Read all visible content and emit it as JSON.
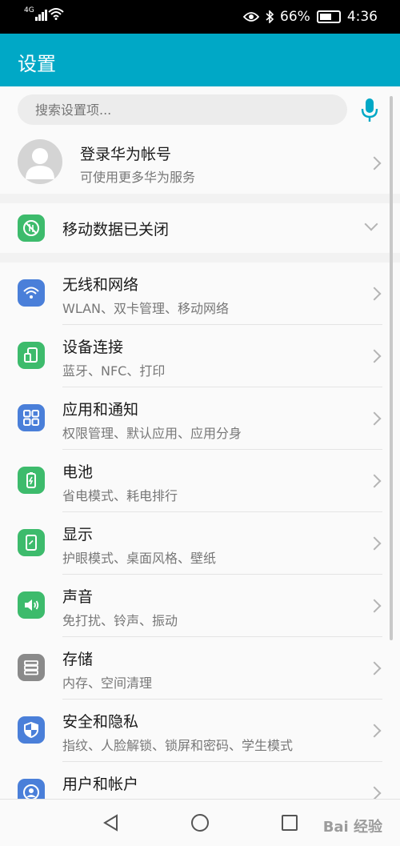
{
  "status_bar": {
    "network": "4G",
    "battery_percent": "66%",
    "time": "4:36"
  },
  "app_bar": {
    "title": "设置"
  },
  "search": {
    "placeholder": "搜索设置项..."
  },
  "account": {
    "title": "登录华为帐号",
    "subtitle": "可使用更多华为服务"
  },
  "mobile_data": {
    "label": "移动数据已关闭"
  },
  "settings": [
    {
      "title": "无线和网络",
      "subtitle": "WLAN、双卡管理、移动网络",
      "icon": "wifi-icon",
      "color": "#4a7fd9"
    },
    {
      "title": "设备连接",
      "subtitle": "蓝牙、NFC、打印",
      "icon": "device-connect-icon",
      "color": "#3dbb6c"
    },
    {
      "title": "应用和通知",
      "subtitle": "权限管理、默认应用、应用分身",
      "icon": "apps-icon",
      "color": "#4a7fd9"
    },
    {
      "title": "电池",
      "subtitle": "省电模式、耗电排行",
      "icon": "battery-icon",
      "color": "#3dbb6c"
    },
    {
      "title": "显示",
      "subtitle": "护眼模式、桌面风格、壁纸",
      "icon": "display-icon",
      "color": "#3dbb6c"
    },
    {
      "title": "声音",
      "subtitle": "免打扰、铃声、振动",
      "icon": "sound-icon",
      "color": "#3dbb6c"
    },
    {
      "title": "存储",
      "subtitle": "内存、空间清理",
      "icon": "storage-icon",
      "color": "#8a8a8a"
    },
    {
      "title": "安全和隐私",
      "subtitle": "指纹、人脸解锁、锁屏和密码、学生模式",
      "icon": "security-icon",
      "color": "#4a7fd9"
    },
    {
      "title": "用户和帐户",
      "subtitle": "",
      "icon": "user-icon",
      "color": "#4a7fd9"
    }
  ],
  "watermark": "Bai 经验",
  "colors": {
    "app_bar": "#00a8c6",
    "mic": "#00a8c6"
  }
}
